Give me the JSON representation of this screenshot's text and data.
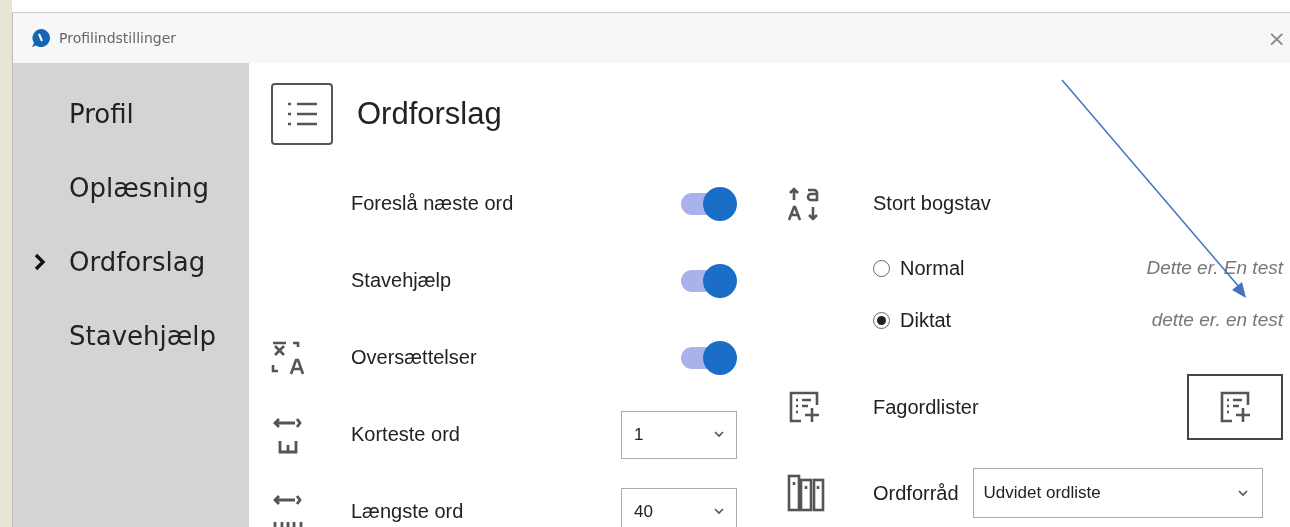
{
  "window": {
    "title": "Profilindstillinger",
    "close": "×"
  },
  "sidebar": {
    "items": [
      {
        "label": "Profil",
        "selected": false
      },
      {
        "label": "Oplæsning",
        "selected": false
      },
      {
        "label": "Ordforslag",
        "selected": true
      },
      {
        "label": "Stavehjælp",
        "selected": false
      }
    ]
  },
  "page": {
    "title": "Ordforslag"
  },
  "left_settings": [
    {
      "kind": "toggle",
      "label": "Foreslå næste ord",
      "on": true
    },
    {
      "kind": "toggle",
      "label": "Stavehjælp",
      "on": true
    },
    {
      "kind": "toggle",
      "label": "Oversættelser",
      "on": true
    },
    {
      "kind": "select",
      "label": "Korteste ord",
      "value": "1"
    },
    {
      "kind": "select",
      "label": "Længste ord",
      "value": "40"
    }
  ],
  "capitalization": {
    "label": "Stort bogstav",
    "options": [
      {
        "label": "Normal",
        "example": "Dette er. En test",
        "selected": false
      },
      {
        "label": "Diktat",
        "example": "dette er. en test",
        "selected": true
      }
    ]
  },
  "word_lists": {
    "label": "Fagordlister"
  },
  "vocabulary": {
    "label": "Ordforråd",
    "value": "Udvidet ordliste"
  }
}
